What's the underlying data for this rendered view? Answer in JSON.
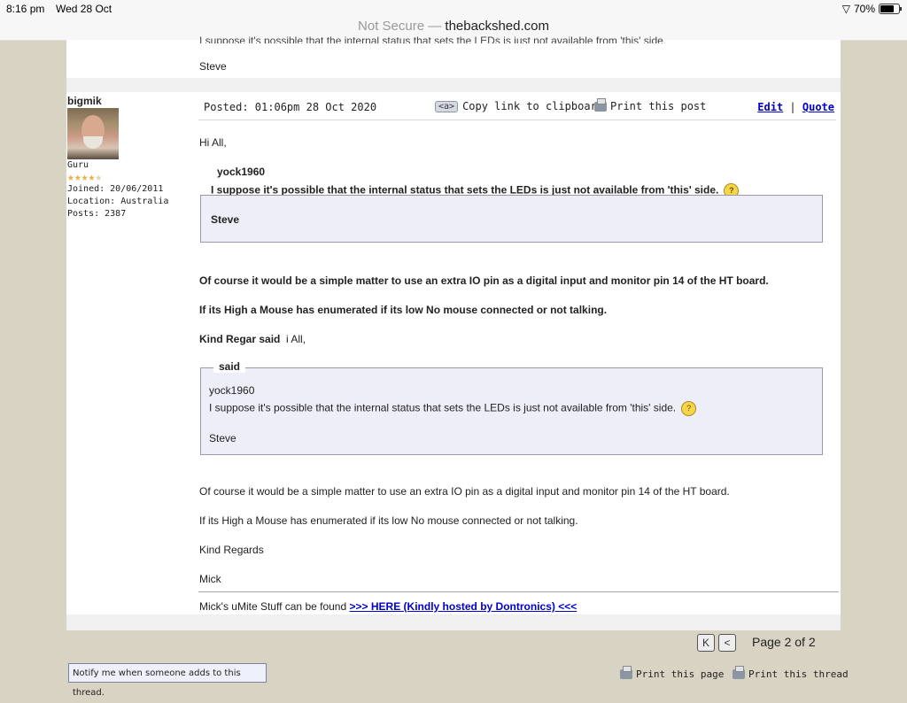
{
  "status": {
    "time": "8:16 pm",
    "date": "Wed 28 Oct",
    "battery": "70%",
    "battery_level": 0.7
  },
  "browser": {
    "security": "Not Secure —",
    "domain": "thebackshed.com"
  },
  "prev_post": {
    "cut_text": "I suppose it's possible that the internal status that sets the LEDs is just not available from 'this' side.",
    "signature": "Steve"
  },
  "user": {
    "name": "bigmik",
    "rank": "Guru",
    "rating": 4,
    "rating_max": 5,
    "joined": "Joined: 20/06/2011",
    "location": "Location: Australia",
    "posts": "Posts: 2387"
  },
  "post": {
    "posted": "Posted: 01:06pm 28 Oct 2020",
    "copy_label": "Copy link to clipboard",
    "copy_icon": "<a>",
    "print_label": "Print this post",
    "edit_label": "Edit",
    "separator": "|",
    "quote_label": "Quote",
    "greeting": "Hi All,",
    "q1_author": "yock1960",
    "q1_text": "I suppose it's possible that the internal status that sets the LEDs is just not available from 'this' side.",
    "q1_sig": "Steve",
    "p1": "Of course it would be a simple matter to use an extra IO pin as a digital input and monitor pin 14 of the HT board.",
    "p2": "If its High a Mouse has enumerated if its low No mouse connected or not talking.",
    "p3_bold": "Kind Regar said",
    "p3_rest": "i All,",
    "q2_legend": "said",
    "q2_author": "yock1960",
    "q2_text": "I suppose it's possible that the internal status that sets the LEDs is just not available from 'this' side.",
    "q2_sig": "Steve",
    "p4": "Of course it would be a simple matter to use an extra IO pin as a digital input and monitor pin 14 of the HT board.",
    "p5": "If its High a Mouse has enumerated if its low No mouse connected or not talking.",
    "p6": "Kind Regards",
    "p7": "Mick",
    "sig_text": "Mick's uMite Stuff can be found",
    "sig_link": ">>> HERE (Kindly hosted by Dontronics) <<<"
  },
  "pager": {
    "first": "K",
    "prev": "<",
    "label": "Page 2 of 2"
  },
  "footer": {
    "notify": "Notify me when someone adds to this thread.",
    "print_page": "Print this page",
    "print_thread": "Print this thread"
  }
}
